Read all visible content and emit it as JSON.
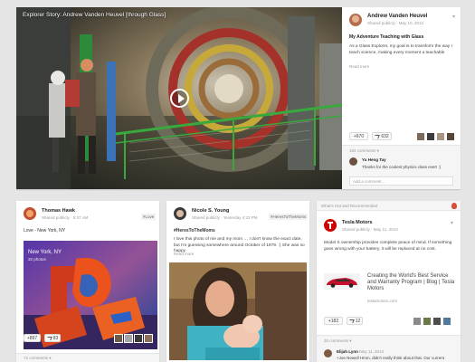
{
  "video_post": {
    "title": "Explorer Story: Andrew Vanden Heuvel [through Glass]",
    "author": "Andrew Vanden Heuvel",
    "visibility": "Shared publicly",
    "date": "May 10, 2013",
    "heading": "My Adventure Teaching with Glass",
    "body": "As a Glass Explorer, my goal is to transform the way I teach science, making every moment a teachable",
    "read_more": "Read more",
    "plus_count": "+670",
    "share_count": "632",
    "comments_count": "184 comments",
    "comment_author": "Yu Heng Tay",
    "comment_text": "Thanks for the coolest physics class ever! :)",
    "comment_placeholder": "Add a comment..."
  },
  "post_thomas": {
    "author": "Thomas Hawk",
    "visibility": "Shared publicly",
    "time": "5:37 AM",
    "tag": "#Love",
    "text": "Love - New York, NY",
    "album_title": "New York, NY",
    "album_count": "32 photos",
    "plus_count": "+897",
    "share_count": "83",
    "comments_count": "72 comments"
  },
  "post_nicole": {
    "author": "Nicole S. Young",
    "visibility": "Shared publicly",
    "time": "Yesterday 4:23 PM",
    "tag": "#HeresToTheMoms",
    "hashtag": "#HeresToTheMoms",
    "body": "I love this photo of me and my mom … I don't know the exact date, but I'm guessing somewhere around October of 1979. :) She was so happy",
    "read_more": "Read more"
  },
  "post_tesla": {
    "section": "What's Hot and Recommended",
    "author": "Tesla Motors",
    "visibility": "Shared publicly",
    "date": "May 11, 2013",
    "body": "Model S ownership provides complete peace of mind. If something goes wrong with your battery, it will be replaced at no cost.",
    "link_title": "Creating the World's Best Service and Warranty Program | Blog | Tesla Motors",
    "link_domain": "teslamotors.com",
    "plus_count": "+182",
    "share_count": "12",
    "comments_count": "30 comments",
    "comment_author": "Elijah Lynn",
    "comment_date": "May 11, 2013",
    "comment_text": "+Joe Newell Hmm, didn't really think about that. Our current"
  },
  "colors": {
    "accent": "#3b78e7",
    "tesla_red": "#cc0000",
    "hot_icon": "#dd4b39"
  }
}
